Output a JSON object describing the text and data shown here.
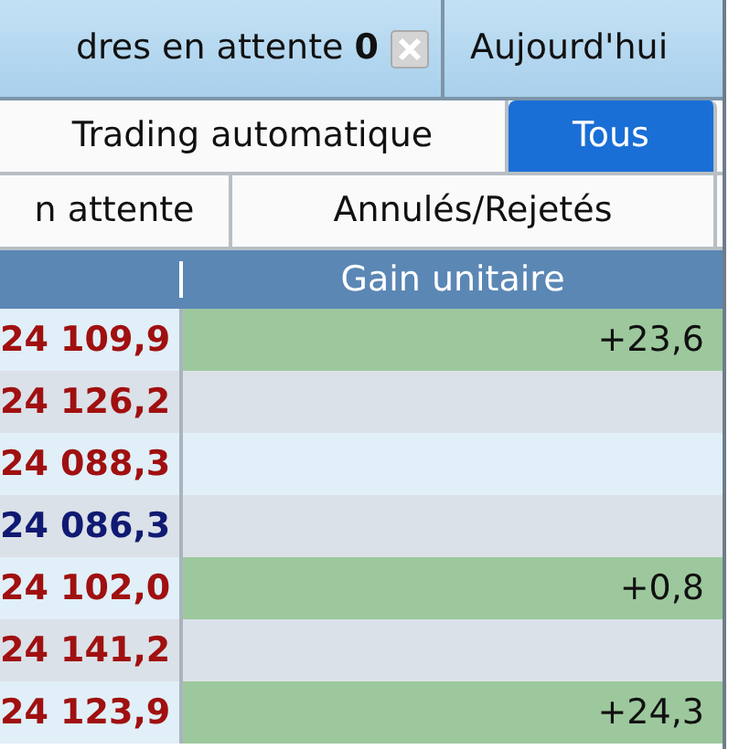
{
  "tabs": [
    {
      "label": "dres en attente **0**",
      "closable": true
    },
    {
      "label": "Aujourd'hui",
      "closable": false
    }
  ],
  "filters": [
    {
      "label": "Trading automatique",
      "selected": false
    },
    {
      "label": "Tous",
      "selected": true
    }
  ],
  "status_filters": [
    {
      "label": "n attente",
      "selected": false
    },
    {
      "label": "Annulés/Rejetés",
      "selected": false
    }
  ],
  "table": {
    "columns": [
      "",
      "Gain unitaire"
    ],
    "rows": [
      {
        "column_1": "24 109,9",
        "color": "#a01010",
        "gain": "+23,6",
        "highlighted": true
      },
      {
        "column_1": "24 126,2",
        "color": "#a01010",
        "gain": "",
        "highlighted": false
      },
      {
        "column_1": "24 088,3",
        "color": "#a01010",
        "gain": "",
        "highlighted": false
      },
      {
        "column_1": "24 086,3",
        "color": "#101a72",
        "gain": "",
        "highlighted": false
      },
      {
        "column_1": "24 102,0",
        "color": "#a01010",
        "gain": "+0,8",
        "highlighted": true
      },
      {
        "column_1": "24 141,2",
        "color": "#a01010",
        "gain": "",
        "highlighted": false
      },
      {
        "column_1": "24 123,9",
        "color": "#a01010",
        "gain": "+24,3",
        "highlighted": true
      }
    ]
  }
}
